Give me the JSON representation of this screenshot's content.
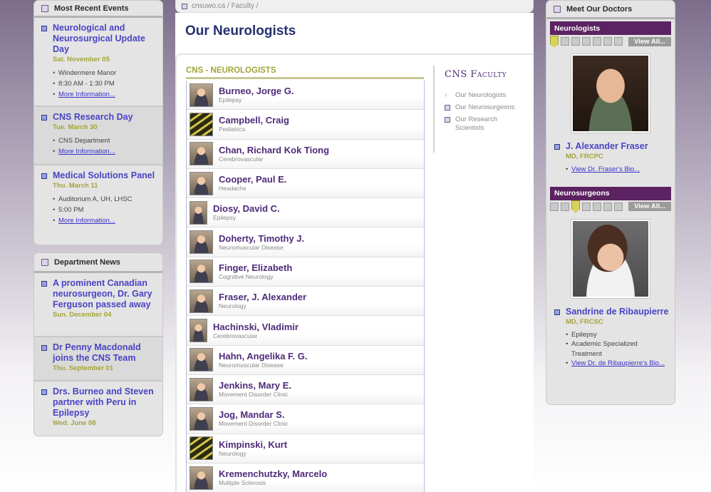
{
  "left": {
    "events": {
      "title": "Most Recent Events",
      "items": [
        {
          "title": "Neurological and Neurosurgical Update Day",
          "date": "Sat. November 05",
          "details": [
            "Windermere Manor",
            "8:30 AM - 1:30 PM"
          ],
          "link": "More Information..."
        },
        {
          "title": "CNS Research Day",
          "date": "Tue. March 30",
          "details": [
            "CNS Department"
          ],
          "link": "More Information..."
        },
        {
          "title": "Medical Solutions Panel",
          "date": "Thu. March 11",
          "details": [
            "Auditorium A, UH, LHSC",
            "5:00 PM"
          ],
          "link": "More Information..."
        }
      ]
    },
    "news": {
      "title": "Department News",
      "items": [
        {
          "title": "A prominent Canadian neurosurgeon, Dr. Gary Ferguson passed away",
          "date": "Sun. December 04"
        },
        {
          "title": "Dr Penny Macdonald joins the CNS Team",
          "date": "Thu. September 01"
        },
        {
          "title": "Drs. Burneo and Steven partner with Peru in Epilepsy",
          "date": "Wed. June 08"
        }
      ]
    }
  },
  "center": {
    "breadcrumb": "cnsuwo.ca / Faculty /",
    "page_title": "Our Neurologists",
    "section_title": "CNS - NEUROLOGISTS",
    "doctors": [
      {
        "name": "Burneo, Jorge G.",
        "specialty": "Epilepsy"
      },
      {
        "name": "Campbell, Craig",
        "specialty": "Pediatrics"
      },
      {
        "name": "Chan, Richard Kok Tiong",
        "specialty": "Cerebrovascular"
      },
      {
        "name": "Cooper, Paul E.",
        "specialty": "Headache"
      },
      {
        "name": "Diosy, David C.",
        "specialty": "Epilepsy"
      },
      {
        "name": "Doherty, Timothy J.",
        "specialty": "Neuromuscular Disease"
      },
      {
        "name": "Finger, Elizabeth",
        "specialty": "Cognitive Neurology"
      },
      {
        "name": "Fraser, J. Alexander",
        "specialty": "Neurology"
      },
      {
        "name": "Hachinski, Vladimir",
        "specialty": "Cerebrovascular"
      },
      {
        "name": "Hahn, Angelika F. G.",
        "specialty": "Neuromuscular Disease"
      },
      {
        "name": "Jenkins, Mary E.",
        "specialty": "Movement Disorder Clinic"
      },
      {
        "name": "Jog, Mandar S.",
        "specialty": "Movement Disorder Clinic"
      },
      {
        "name": "Kimpinski, Kurt",
        "specialty": "Neurology"
      },
      {
        "name": "Kremenchutzky, Marcelo",
        "specialty": "Multiple Sclerosis"
      }
    ],
    "faculty": {
      "title": "CNS Faculty",
      "items": [
        "Our Neurologists",
        "Our Neurosurgeons",
        "Our Research Scientists"
      ]
    }
  },
  "right": {
    "title": "Meet Our Doctors",
    "neurologists": {
      "label": "Neurologists",
      "view_all": "View All...",
      "doctor": {
        "name": "J. Alexander Fraser",
        "credentials": "MD, FRCPC",
        "link": "View Dr. Fraser's Bio..."
      }
    },
    "neurosurgeons": {
      "label": "Neurosurgeons",
      "view_all": "View All...",
      "doctor": {
        "name": "Sandrine de Ribaupierre",
        "credentials": "MD, FRCSC",
        "interests": [
          "Epilepsy",
          "Academic Specialized Treatment"
        ],
        "link": "View Dr. de Ribaupierre's Bio..."
      }
    }
  }
}
